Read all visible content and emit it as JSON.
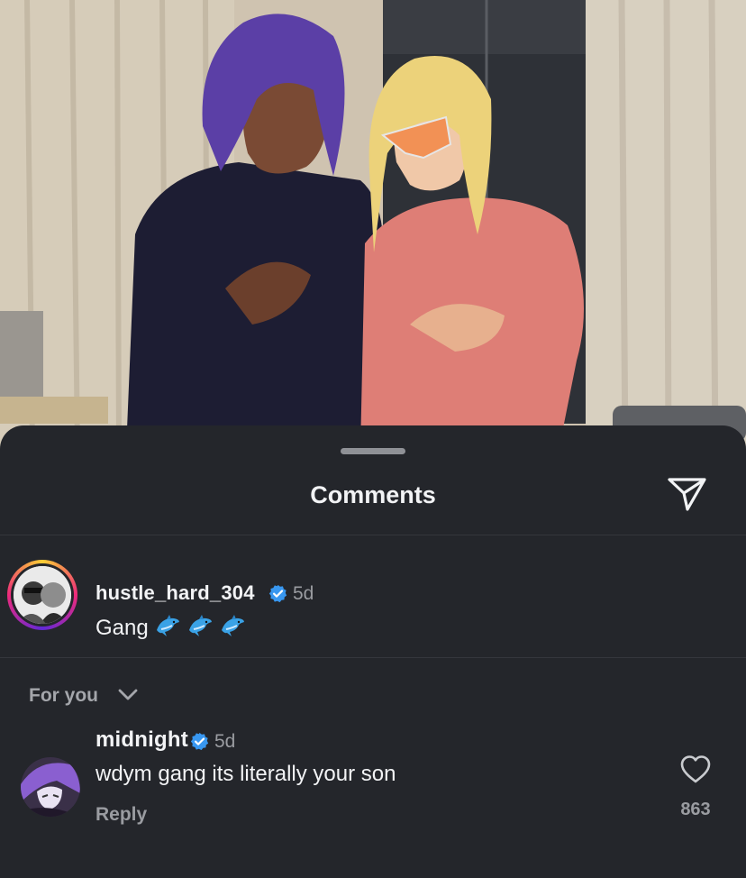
{
  "sheet": {
    "title": "Comments",
    "send_icon": "paper-plane-icon"
  },
  "pinned_comment": {
    "username": "hustle_hard_304",
    "verified": true,
    "time": "5d",
    "text": "Gang",
    "emojis": [
      "dolphin",
      "dolphin",
      "dolphin"
    ],
    "avatar_ring_colors": [
      "#f9ce34",
      "#ee2a7b",
      "#6228d7"
    ]
  },
  "filter": {
    "label": "For you",
    "icon": "chevron-down-icon"
  },
  "comments": [
    {
      "username": "midnight",
      "verified": true,
      "time": "5d",
      "text": "wdym gang its literally your son",
      "reply_label": "Reply",
      "likes": "863",
      "like_icon": "heart-outline-icon"
    }
  ],
  "colors": {
    "sheet_bg": "#24262b",
    "verified_blue": "#3897f0",
    "primary_text": "#f2f3f5",
    "secondary_text": "#9a9ca1"
  }
}
